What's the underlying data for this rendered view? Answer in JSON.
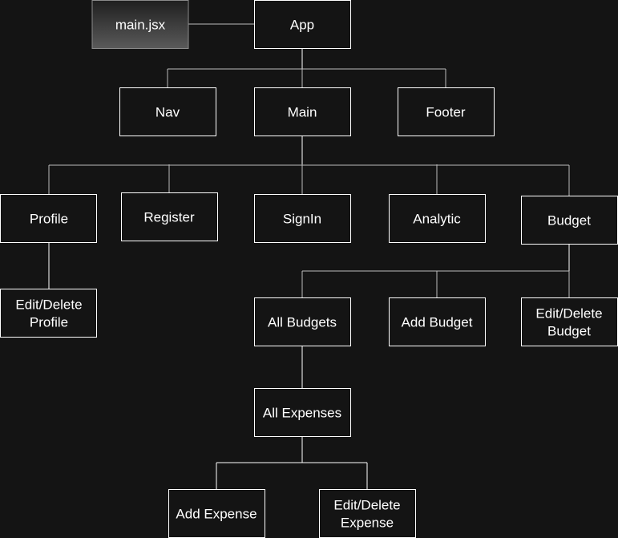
{
  "diagram": {
    "nodes": {
      "main_jsx": "main.jsx",
      "app": "App",
      "nav": "Nav",
      "main": "Main",
      "footer": "Footer",
      "profile": "Profile",
      "register": "Register",
      "signin": "SignIn",
      "analytic": "Analytic",
      "budget": "Budget",
      "edit_delete_profile": [
        "Edit/Delete",
        "Profile"
      ],
      "all_budgets": "All Budgets",
      "add_budget": "Add Budget",
      "edit_delete_budget": [
        "Edit/Delete",
        "Budget"
      ],
      "all_expenses": "All Expenses",
      "add_expense": "Add Expense",
      "edit_delete_expense": [
        "Edit/Delete",
        "Expense"
      ]
    },
    "edges": [
      [
        "main_jsx",
        "app"
      ],
      [
        "app",
        "nav"
      ],
      [
        "app",
        "main"
      ],
      [
        "app",
        "footer"
      ],
      [
        "main",
        "profile"
      ],
      [
        "main",
        "register"
      ],
      [
        "main",
        "signin"
      ],
      [
        "main",
        "analytic"
      ],
      [
        "main",
        "budget"
      ],
      [
        "profile",
        "edit_delete_profile"
      ],
      [
        "budget",
        "all_budgets"
      ],
      [
        "budget",
        "add_budget"
      ],
      [
        "budget",
        "edit_delete_budget"
      ],
      [
        "all_budgets",
        "all_expenses"
      ],
      [
        "all_expenses",
        "add_expense"
      ],
      [
        "all_expenses",
        "edit_delete_expense"
      ]
    ]
  }
}
